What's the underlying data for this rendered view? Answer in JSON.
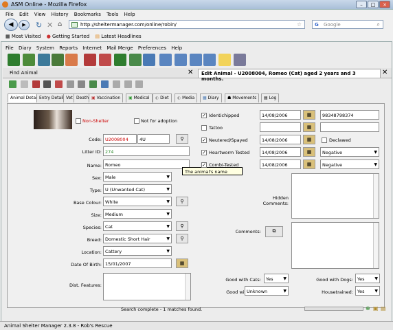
{
  "window": {
    "title": "ASM Online - Mozilla Firefox"
  },
  "firefox_menu": [
    "File",
    "Edit",
    "View",
    "History",
    "Bookmarks",
    "Tools",
    "Help"
  ],
  "nav": {
    "url": "http://sheltermanager.com/online/robin/",
    "search_placeholder": "Google"
  },
  "bookmarks": [
    "Most Visited",
    "Getting Started",
    "Latest Headlines"
  ],
  "app_menu": [
    "File",
    "Diary",
    "System",
    "Reports",
    "Internet",
    "Mail Merge",
    "Preferences",
    "Help"
  ],
  "doc_tabs": {
    "find": "Find Animal",
    "edit": "Edit Animal - U2008004, Romeo (Cat) aged 2 years and 3 months."
  },
  "form_tabs": [
    "Animal Details",
    "Entry Details",
    "Vet",
    "Death",
    "Vaccination",
    "Medical",
    "Diet",
    "Media",
    "Diary",
    "Movements",
    "Log"
  ],
  "left": {
    "non_shelter": "Non-Shelter",
    "not_for_adoption": "Not for adoption",
    "code_label": "Code:",
    "code_value": "U2008004",
    "code_short": "4U",
    "litter_label": "Litter ID:",
    "litter_value": "274",
    "name_label": "Name:",
    "name_value": "Romeo",
    "sex_label": "Sex:",
    "sex_value": "Male",
    "type_label": "Type:",
    "type_value": "U (Unwanted Cat)",
    "basecolour_label": "Base Colour:",
    "basecolour_value": "White",
    "size_label": "Size:",
    "size_value": "Medium",
    "species_label": "Species:",
    "species_value": "Cat",
    "breed_label": "Breed:",
    "breed_value": "Domestic Short Hair",
    "location_label": "Location:",
    "location_value": "Cattery",
    "dob_label": "Date Of Birth:",
    "dob_value": "15/01/2007",
    "features_label": "Dist. Features:"
  },
  "right": {
    "identichipped": "Identichipped",
    "identichipped_date": "14/08/2006",
    "chip_number": "98348798374",
    "tattoo": "Tattoo",
    "neutered": "Neutered/Spayed",
    "neutered_date": "14/08/2006",
    "declawed": "Declawed",
    "heartworm": "Heartworm Tested",
    "heartworm_date": "14/08/2006",
    "heartworm_result": "Negative",
    "combi": "Combi-Tested",
    "combi_date": "14/08/2006",
    "combi_result": "Negative",
    "hidden_comments_label": "Hidden Comments:",
    "comments_label": "Comments:"
  },
  "bottom": {
    "good_cats_label": "Good with Cats:",
    "good_cats_value": "Yes",
    "good_dogs_label": "Good with Dogs:",
    "good_dogs_value": "Yes",
    "good_kids_label": "Good with Kids:",
    "good_kids_value": "Unknown",
    "housetrained_label": "Housetrained:",
    "housetrained_value": "Yes"
  },
  "tooltip": "The animal's name",
  "status": {
    "app": "Search complete - 1 matches found.",
    "firefox": "Animal Shelter Manager 2.3.8 - Rob's Rescue"
  },
  "colors": {
    "accent": "#3a6ea5",
    "code_red": "#cc0000"
  }
}
